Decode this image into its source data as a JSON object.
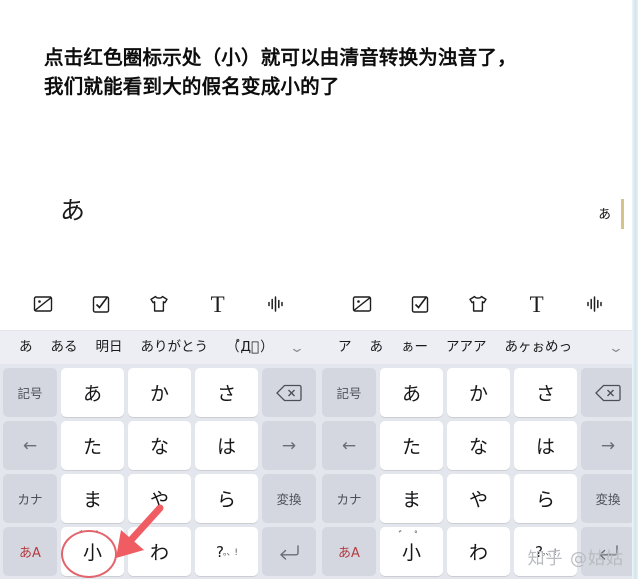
{
  "caption": {
    "text": "点击红色圈标示处（小）就可以由清音转换为浊音了，\n我们就能看到大的假名变成小的了"
  },
  "colors": {
    "annotation_red": "#e2646c",
    "accent_key_red": "#b33a3f",
    "keyboard_bg": "#e4e6ed",
    "key_bg": "#ffffff",
    "fn_key_bg": "#d4d7e0",
    "candidate_bar_bg": "#eceef3",
    "caret": "#d6c38a",
    "edge_strip": "#cfe4ea",
    "watermark": "#b9bbc1"
  },
  "toolbar": {
    "icons": [
      {
        "name": "image-icon",
        "label": "image"
      },
      {
        "name": "checkbox-icon",
        "label": "checkbox"
      },
      {
        "name": "tshirt-icon",
        "label": "t-shirt"
      },
      {
        "name": "text-icon",
        "label": "T"
      },
      {
        "name": "voice-waveform-icon",
        "label": "voice"
      }
    ],
    "text_glyph": "T"
  },
  "left_panel": {
    "compose_text": "あ",
    "candidates": [
      "あ",
      "ある",
      "明日",
      "ありがとう",
      "（゚Д゚）"
    ],
    "candidate_chevron": "⌄",
    "keyboard": {
      "rows": [
        [
          {
            "label": "記号",
            "name": "key-symbols",
            "type": "fn"
          },
          {
            "label": "あ",
            "name": "key-a",
            "type": "char"
          },
          {
            "label": "か",
            "name": "key-ka",
            "type": "char"
          },
          {
            "label": "さ",
            "name": "key-sa",
            "type": "char"
          },
          {
            "label": "",
            "name": "key-backspace",
            "type": "backspace"
          }
        ],
        [
          {
            "label": "←",
            "name": "key-cursor-left",
            "type": "arrow"
          },
          {
            "label": "た",
            "name": "key-ta",
            "type": "char"
          },
          {
            "label": "な",
            "name": "key-na",
            "type": "char"
          },
          {
            "label": "は",
            "name": "key-ha",
            "type": "char"
          },
          {
            "label": "→",
            "name": "key-cursor-right",
            "type": "arrow"
          }
        ],
        [
          {
            "label": "カナ",
            "name": "key-kana",
            "type": "fn"
          },
          {
            "label": "ま",
            "name": "key-ma",
            "type": "char"
          },
          {
            "label": "や",
            "name": "key-ya",
            "type": "char"
          },
          {
            "label": "ら",
            "name": "key-ra",
            "type": "char"
          },
          {
            "label": "変換",
            "name": "key-convert",
            "type": "fn"
          }
        ],
        [
          {
            "label": "あA",
            "name": "key-input-mode",
            "type": "accent"
          },
          {
            "label": "小",
            "name": "key-small-dakuten",
            "type": "char",
            "marks": "゛゜",
            "highlighted": true
          },
          {
            "label": "わ",
            "name": "key-wa",
            "type": "char"
          },
          {
            "label": "?",
            "name": "key-punctuation",
            "type": "punct",
            "sub": "。、!"
          },
          {
            "label": "",
            "name": "key-enter",
            "type": "enter"
          }
        ]
      ]
    }
  },
  "right_panel": {
    "compose_text": "ぁ",
    "candidates": [
      "ア",
      "あ",
      "ぁー",
      "アアア",
      "あヶぉめっ"
    ],
    "candidate_chevron": "⌄",
    "keyboard": {
      "rows": [
        [
          {
            "label": "記号",
            "name": "key-symbols",
            "type": "fn"
          },
          {
            "label": "あ",
            "name": "key-a",
            "type": "char"
          },
          {
            "label": "か",
            "name": "key-ka",
            "type": "char"
          },
          {
            "label": "さ",
            "name": "key-sa",
            "type": "char"
          },
          {
            "label": "",
            "name": "key-backspace",
            "type": "backspace"
          }
        ],
        [
          {
            "label": "←",
            "name": "key-cursor-left",
            "type": "arrow"
          },
          {
            "label": "た",
            "name": "key-ta",
            "type": "char"
          },
          {
            "label": "な",
            "name": "key-na",
            "type": "char"
          },
          {
            "label": "は",
            "name": "key-ha",
            "type": "char"
          },
          {
            "label": "→",
            "name": "key-cursor-right",
            "type": "arrow"
          }
        ],
        [
          {
            "label": "カナ",
            "name": "key-kana",
            "type": "fn"
          },
          {
            "label": "ま",
            "name": "key-ma",
            "type": "char"
          },
          {
            "label": "や",
            "name": "key-ya",
            "type": "char"
          },
          {
            "label": "ら",
            "name": "key-ra",
            "type": "char"
          },
          {
            "label": "変換",
            "name": "key-convert",
            "type": "fn"
          }
        ],
        [
          {
            "label": "あA",
            "name": "key-input-mode",
            "type": "accent"
          },
          {
            "label": "小",
            "name": "key-small-dakuten",
            "type": "char",
            "marks": "゛゜"
          },
          {
            "label": "わ",
            "name": "key-wa",
            "type": "char"
          },
          {
            "label": "?",
            "name": "key-punctuation",
            "type": "punct",
            "sub": "。、!"
          },
          {
            "label": "",
            "name": "key-enter",
            "type": "enter"
          }
        ]
      ]
    }
  },
  "watermark": {
    "text": "知乎 @姑姑"
  }
}
